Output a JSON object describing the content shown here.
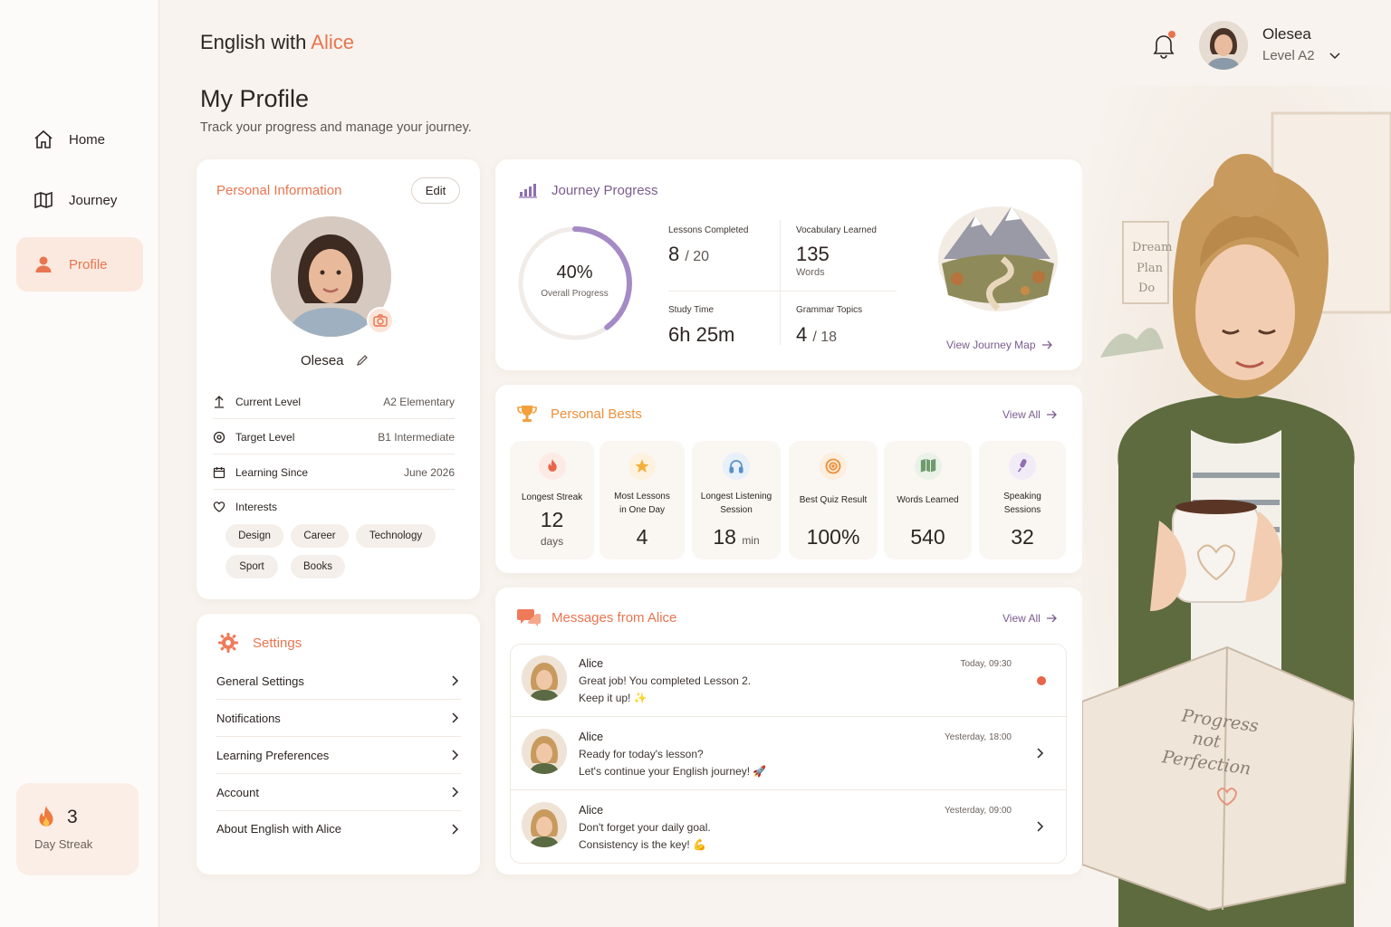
{
  "brand": {
    "prefix": "English with",
    "accent": "Alice"
  },
  "nav": [
    {
      "label": "Home",
      "icon": "home-icon"
    },
    {
      "label": "Journey",
      "icon": "map-icon"
    },
    {
      "label": "Profile",
      "icon": "user-icon",
      "active": true
    }
  ],
  "streak": {
    "value": "3",
    "label": "Day Streak"
  },
  "header": {
    "title": "My Profile",
    "subtitle": "Track your progress and manage your journey."
  },
  "user": {
    "name": "Olesea",
    "level": "Level A2"
  },
  "personal_info": {
    "title": "Personal Information",
    "edit_label": "Edit",
    "name": "Olesea",
    "rows": [
      {
        "label": "Current Level",
        "value": "A2 Elementary"
      },
      {
        "label": "Target Level",
        "value": "B1 Intermediate"
      },
      {
        "label": "Learning Since",
        "value": "June 2026"
      },
      {
        "label": "Interests",
        "value": ""
      }
    ],
    "interests": [
      "Design",
      "Career",
      "Technology",
      "Sport",
      "Books"
    ]
  },
  "settings": {
    "title": "Settings",
    "items": [
      "General Settings",
      "Notifications",
      "Learning Preferences",
      "Account",
      "About English with Alice"
    ]
  },
  "journey": {
    "title": "Journey Progress",
    "progress": 0.4,
    "percent_label": "40%",
    "overall_label": "Overall Progress",
    "lessons": {
      "label": "Lessons Completed",
      "value": "8",
      "total": "/ 20"
    },
    "vocab": {
      "label": "Vocabulary Learned",
      "value": "135",
      "unit": "Words"
    },
    "study": {
      "label": "Study Time",
      "value": "6h 25m"
    },
    "grammar": {
      "label": "Grammar Topics",
      "value": "4",
      "total": "/ 18"
    },
    "link": "View Journey Map"
  },
  "bests": {
    "title": "Personal Bests",
    "view_all": "View All",
    "tiles": [
      {
        "label1": "Longest Streak",
        "label2": "",
        "value": "12",
        "unit": "days",
        "icon": "flame-icon",
        "color": "#e8654a"
      },
      {
        "label1": "Most Lessons",
        "label2": "in One Day",
        "value": "4",
        "unit": "",
        "icon": "star-icon",
        "color": "#f2b13c"
      },
      {
        "label1": "Longest Listening",
        "label2": "Session",
        "value": "18",
        "unit": "min",
        "icon": "headphones-icon",
        "color": "#5b8fc9"
      },
      {
        "label1": "Best Quiz Result",
        "label2": "",
        "value": "100%",
        "unit": "",
        "icon": "target-icon",
        "color": "#ef8f3a"
      },
      {
        "label1": "Words Learned",
        "label2": "",
        "value": "540",
        "unit": "",
        "icon": "book-icon",
        "color": "#6f9a6e"
      },
      {
        "label1": "Speaking",
        "label2": "Sessions",
        "value": "32",
        "unit": "",
        "icon": "microphone-icon",
        "color": "#8e6fb0"
      }
    ]
  },
  "messages": {
    "title": "Messages from Alice",
    "view_all": "View All",
    "items": [
      {
        "sender": "Alice",
        "line1": "Great job! You completed Lesson 2.",
        "line2": "Keep it up! ✨",
        "time": "Today, 09:30",
        "unread": true
      },
      {
        "sender": "Alice",
        "line1": "Ready for today's lesson?",
        "line2": "Let's continue your English journey! 🚀",
        "time": "Yesterday, 18:00",
        "unread": false
      },
      {
        "sender": "Alice",
        "line1": "Don't forget your daily goal.",
        "line2": "Consistency is the key! 💪",
        "time": "Yesterday, 09:00",
        "unread": false
      }
    ]
  },
  "illustration": {
    "poster": [
      "Dream",
      "Plan",
      "Do"
    ],
    "book": [
      "Progress",
      "not",
      "Perfection"
    ]
  }
}
